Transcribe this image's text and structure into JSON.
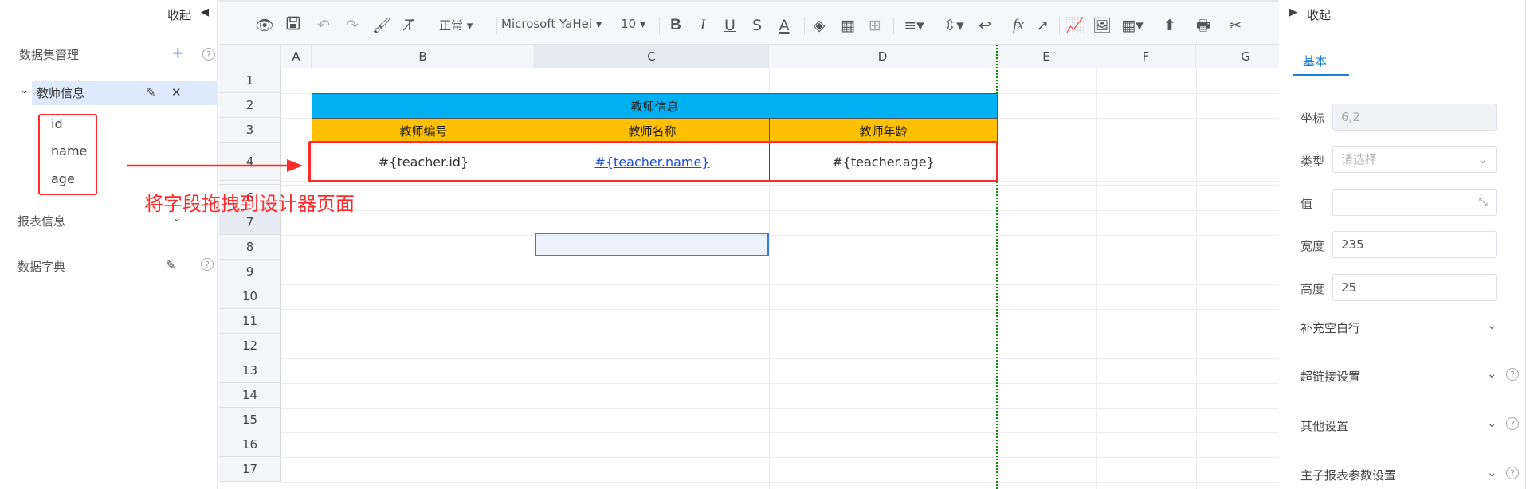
{
  "left_panel": {
    "collapse_label": "收起",
    "dataset_title": "数据集管理",
    "add_symbol": "+",
    "help_symbol": "?",
    "dataset": {
      "name": "教师信息",
      "edit_symbol": "✎",
      "delete_symbol": "✕",
      "fields": [
        "id",
        "name",
        "age"
      ]
    },
    "report_info_label": "报表信息",
    "data_dict_label": "数据字典"
  },
  "annotation": {
    "text": "将字段拖拽到设计器页面",
    "color": "#ff2a2a"
  },
  "toolbar": {
    "preview_icon": "eye-icon",
    "font_style": "正常",
    "font_family": "Microsoft YaHei",
    "font_size": "10",
    "bold_label": "B",
    "italic_label": "I",
    "underline_label": "U",
    "strike_label": "S",
    "color_label": "A",
    "fx_label": "fx"
  },
  "sheet": {
    "columns": [
      "A",
      "B",
      "C",
      "D",
      "E",
      "F",
      "G"
    ],
    "rows": [
      "1",
      "2",
      "3",
      "4",
      "6",
      "7",
      "8",
      "9",
      "10",
      "11",
      "12",
      "13",
      "14",
      "15",
      "16",
      "17"
    ],
    "title_cell": "教师信息",
    "header_cells": [
      "教师编号",
      "教师名称",
      "教师年龄"
    ],
    "data_cells": [
      "#{teacher.id}",
      "#{teacher.name}",
      "#{teacher.age}"
    ],
    "header_blue": "#00b0f0",
    "header_orange": "#ffc000",
    "link_color": "#1a4fd6"
  },
  "right_panel": {
    "collapse_label": "收起",
    "tab_basic": "基本",
    "coord_label": "坐标",
    "coord_value": "6,2",
    "type_label": "类型",
    "type_placeholder": "请选择",
    "value_label": "值",
    "width_label": "宽度",
    "width_value": "235",
    "height_label": "高度",
    "height_value": "25",
    "sections": [
      "补充空白行",
      "超链接设置",
      "其他设置",
      "主子报表参数设置"
    ]
  },
  "accent_color": "#1e7fd8"
}
